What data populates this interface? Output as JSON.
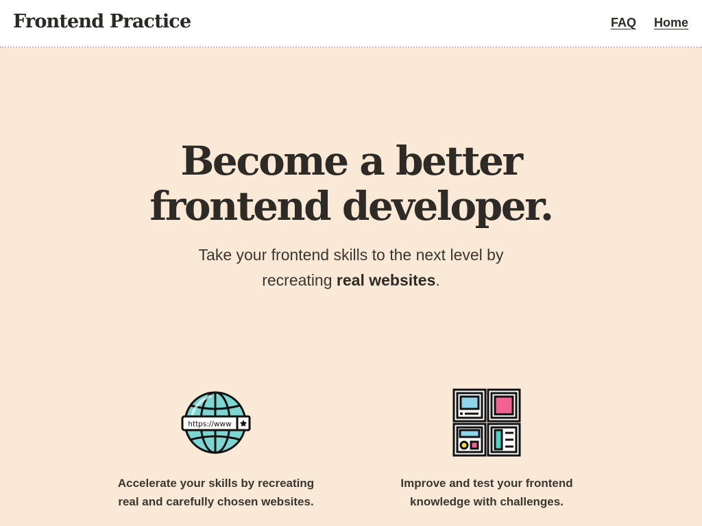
{
  "header": {
    "logo": "Frontend Practice",
    "nav": [
      {
        "label": "FAQ"
      },
      {
        "label": "Home"
      }
    ]
  },
  "hero": {
    "title_line1": "Become a better",
    "title_line2": "frontend developer.",
    "subtitle_line1": "Take your frontend skills to the next level by",
    "subtitle_line2_prefix": "recreating",
    "subtitle_line2_bold": "real websites",
    "subtitle_line2_suffix": "."
  },
  "features": [
    {
      "icon": "globe-www-icon",
      "url_text": "https://www",
      "line1": "Accelerate your skills by recreating",
      "line2": "real and carefully chosen websites."
    },
    {
      "icon": "layout-grid-icon",
      "line1": "Improve and test your frontend",
      "line2": "knowledge with challenges."
    }
  ],
  "colors": {
    "background": "#f9e9d6",
    "header_bg": "#ffffff",
    "text": "#2e2b26",
    "globe_teal": "#7ed6d2",
    "tile_blue": "#8fd3ec",
    "tile_pink": "#f06292",
    "tile_teal": "#4fd1c5",
    "tile_yellow": "#f6d74a"
  }
}
